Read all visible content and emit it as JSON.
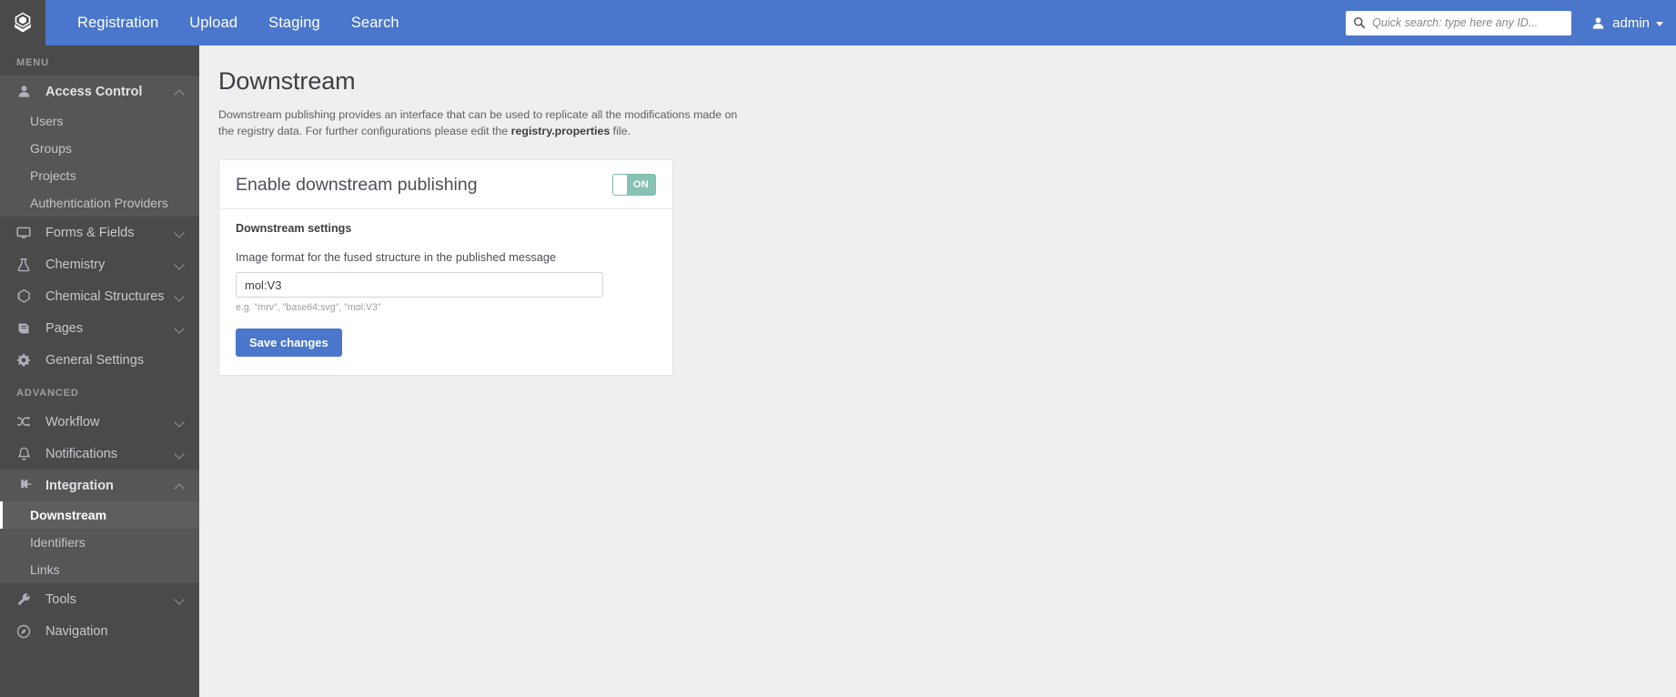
{
  "topbar": {
    "logo_icon": "cube-package-icon",
    "nav": [
      {
        "label": "Registration",
        "name": "nav-registration"
      },
      {
        "label": "Upload",
        "name": "nav-upload"
      },
      {
        "label": "Staging",
        "name": "nav-staging"
      },
      {
        "label": "Search",
        "name": "nav-search"
      }
    ],
    "search": {
      "icon": "search-icon",
      "placeholder": "Quick search: type here any ID...",
      "value": ""
    },
    "user": {
      "icon": "person-icon",
      "label": "admin",
      "caret": "chevron-down-icon"
    },
    "accent_color": "#4a76cc"
  },
  "sidebar": {
    "bg_color": "#4a4a4a",
    "sections": [
      {
        "label": "MENU",
        "items": [
          {
            "label": "Access Control",
            "icon": "person-icon",
            "expanded": true,
            "chevron": "chevron-up-icon",
            "children": [
              {
                "label": "Users",
                "active": false
              },
              {
                "label": "Groups",
                "active": false
              },
              {
                "label": "Projects",
                "active": false
              },
              {
                "label": "Authentication Providers",
                "active": false
              }
            ]
          },
          {
            "label": "Forms & Fields",
            "icon": "monitor-icon",
            "expanded": false,
            "chevron": "chevron-down-icon",
            "children": []
          },
          {
            "label": "Chemistry",
            "icon": "flask-icon",
            "expanded": false,
            "chevron": "chevron-down-icon",
            "children": []
          },
          {
            "label": "Chemical Structures",
            "icon": "benzene-ring-icon",
            "expanded": false,
            "chevron": "chevron-down-icon",
            "children": []
          },
          {
            "label": "Pages",
            "icon": "book-icon",
            "expanded": false,
            "chevron": "chevron-down-icon",
            "children": []
          },
          {
            "label": "General Settings",
            "icon": "gear-icon",
            "expanded": false,
            "chevron": null,
            "children": []
          }
        ]
      },
      {
        "label": "ADVANCED",
        "items": [
          {
            "label": "Workflow",
            "icon": "shuffle-icon",
            "expanded": false,
            "chevron": "chevron-down-icon",
            "children": []
          },
          {
            "label": "Notifications",
            "icon": "bell-icon",
            "expanded": false,
            "chevron": "chevron-down-icon",
            "children": []
          },
          {
            "label": "Integration",
            "icon": "puzzle-piece-icon",
            "expanded": true,
            "chevron": "chevron-up-icon",
            "children": [
              {
                "label": "Downstream",
                "active": true
              },
              {
                "label": "Identifiers",
                "active": false
              },
              {
                "label": "Links",
                "active": false
              }
            ]
          },
          {
            "label": "Tools",
            "icon": "wrench-icon",
            "expanded": false,
            "chevron": "chevron-down-icon",
            "children": []
          },
          {
            "label": "Navigation",
            "icon": "compass-icon",
            "expanded": false,
            "chevron": null,
            "children": []
          }
        ]
      }
    ]
  },
  "main": {
    "title": "Downstream",
    "description_part1": "Downstream publishing provides an interface that can be used to replicate all the modifications made on the registry data. For further configurations please edit the ",
    "description_bold": "registry.properties",
    "description_part2": " file.",
    "panel": {
      "header_title": "Enable downstream publishing",
      "toggle": {
        "state_label": "ON",
        "enabled": true,
        "on_color": "#87c3b4"
      },
      "settings_title": "Downstream settings",
      "field_label": "Image format for the fused structure in the published message",
      "field_value": "mol:V3",
      "field_placeholder": "",
      "help_text": "e.g. \"mrv\", \"base64:svg\", \"mol:V3\"",
      "save_button": "Save changes"
    }
  }
}
